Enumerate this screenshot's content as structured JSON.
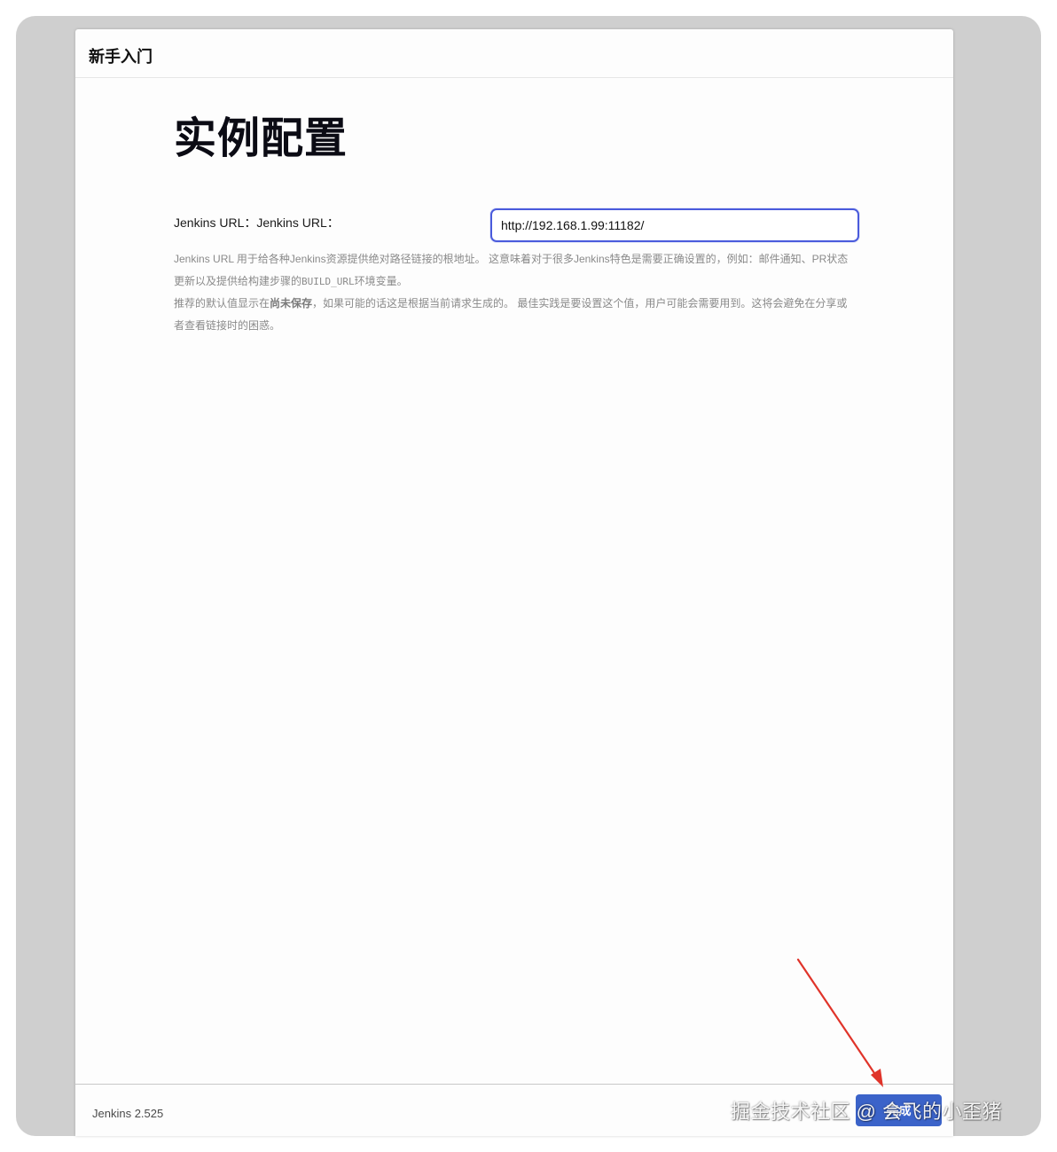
{
  "dialog": {
    "title": "新手入门"
  },
  "main": {
    "page_title": "实例配置",
    "url_field": {
      "label": "Jenkins URL：Jenkins URL：",
      "value": "http://192.168.1.99:11182/"
    },
    "help": {
      "p1_part1": "Jenkins URL 用于给各种Jenkins资源提供绝对路径链接的根地址。 这意味着对于很多Jenkins特色是需要正确设置的，例如：邮件通知、PR状态更新以及提供给构建步骤的",
      "p1_code": "BUILD_URL",
      "p1_part2": "环境变量。",
      "p2_part1": "推荐的默认值显示在",
      "p2_strong": "尚未保存",
      "p2_part2": "，如果可能的话这是根据当前请求生成的。 最佳实践是要设置这个值，用户可能会需要用到。这将会避免在分享或者查看链接时的困惑。"
    }
  },
  "footer": {
    "version": "Jenkins 2.525",
    "finish_label": "完成"
  },
  "overlay": {
    "watermark": "掘金技术社区 @ 会飞的小歪猪",
    "arrow_color": "#e0342a"
  },
  "colors": {
    "accent": "#3b63c9",
    "input_focus": "#4a5bdc"
  }
}
